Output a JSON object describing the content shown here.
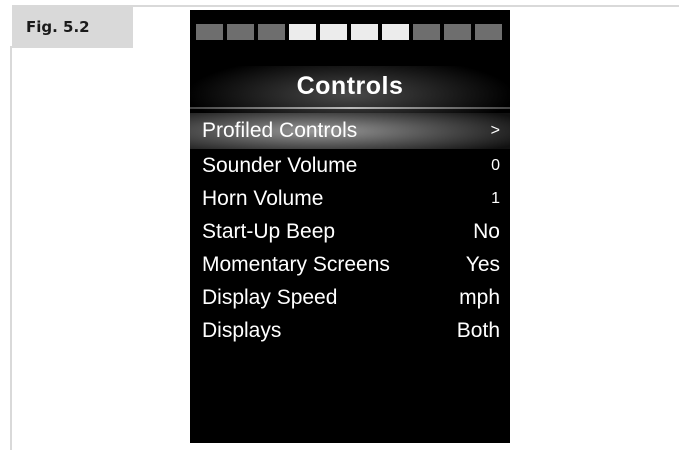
{
  "figure_label": "Fig. 5.2",
  "screen": {
    "segments": [
      {
        "lit": false
      },
      {
        "lit": false
      },
      {
        "lit": false
      },
      {
        "lit": true
      },
      {
        "lit": true
      },
      {
        "lit": true
      },
      {
        "lit": true
      },
      {
        "lit": false
      },
      {
        "lit": false
      },
      {
        "lit": false
      }
    ],
    "title": "Controls",
    "menu": [
      {
        "label": "Profiled Controls",
        "value": ">",
        "selected": true
      },
      {
        "label": "Sounder Volume",
        "value": "0",
        "selected": false
      },
      {
        "label": "Horn Volume",
        "value": "1",
        "selected": false
      },
      {
        "label": "Start-Up Beep",
        "value": "No",
        "selected": false
      },
      {
        "label": "Momentary Screens",
        "value": "Yes",
        "selected": false
      },
      {
        "label": "Display Speed",
        "value": "mph",
        "selected": false
      },
      {
        "label": "Displays",
        "value": "Both",
        "selected": false
      }
    ]
  },
  "colors": {
    "tag_background": "#d9d9d9",
    "screen_background": "#000000",
    "text": "#ffffff",
    "segment_lit": "#ececec",
    "segment_dim": "#6e6e6e"
  }
}
